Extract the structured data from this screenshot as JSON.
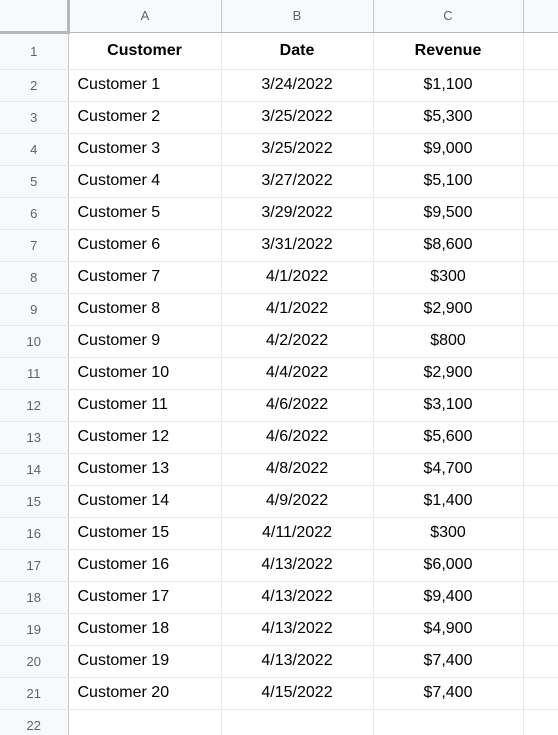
{
  "spreadsheet": {
    "column_headers": [
      "A",
      "B",
      "C",
      ""
    ],
    "header_row": {
      "number": "1",
      "cells": [
        "Customer",
        "Date",
        "Revenue"
      ]
    },
    "rows": [
      {
        "number": "2",
        "cells": [
          "Customer 1",
          "3/24/2022",
          "$1,100"
        ]
      },
      {
        "number": "3",
        "cells": [
          "Customer 2",
          "3/25/2022",
          "$5,300"
        ]
      },
      {
        "number": "4",
        "cells": [
          "Customer 3",
          "3/25/2022",
          "$9,000"
        ]
      },
      {
        "number": "5",
        "cells": [
          "Customer 4",
          "3/27/2022",
          "$5,100"
        ]
      },
      {
        "number": "6",
        "cells": [
          "Customer 5",
          "3/29/2022",
          "$9,500"
        ]
      },
      {
        "number": "7",
        "cells": [
          "Customer 6",
          "3/31/2022",
          "$8,600"
        ]
      },
      {
        "number": "8",
        "cells": [
          "Customer 7",
          "4/1/2022",
          "$300"
        ]
      },
      {
        "number": "9",
        "cells": [
          "Customer 8",
          "4/1/2022",
          "$2,900"
        ]
      },
      {
        "number": "10",
        "cells": [
          "Customer 9",
          "4/2/2022",
          "$800"
        ]
      },
      {
        "number": "11",
        "cells": [
          "Customer 10",
          "4/4/2022",
          "$2,900"
        ]
      },
      {
        "number": "12",
        "cells": [
          "Customer 11",
          "4/6/2022",
          "$3,100"
        ]
      },
      {
        "number": "13",
        "cells": [
          "Customer 12",
          "4/6/2022",
          "$5,600"
        ]
      },
      {
        "number": "14",
        "cells": [
          "Customer 13",
          "4/8/2022",
          "$4,700"
        ]
      },
      {
        "number": "15",
        "cells": [
          "Customer 14",
          "4/9/2022",
          "$1,400"
        ]
      },
      {
        "number": "16",
        "cells": [
          "Customer 15",
          "4/11/2022",
          "$300"
        ]
      },
      {
        "number": "17",
        "cells": [
          "Customer 16",
          "4/13/2022",
          "$6,000"
        ]
      },
      {
        "number": "18",
        "cells": [
          "Customer 17",
          "4/13/2022",
          "$9,400"
        ]
      },
      {
        "number": "19",
        "cells": [
          "Customer 18",
          "4/13/2022",
          "$4,900"
        ]
      },
      {
        "number": "20",
        "cells": [
          "Customer 19",
          "4/13/2022",
          "$7,400"
        ]
      },
      {
        "number": "21",
        "cells": [
          "Customer 20",
          "4/15/2022",
          "$7,400"
        ]
      }
    ],
    "empty_rows": [
      {
        "number": "22",
        "cells": [
          "",
          "",
          ""
        ]
      }
    ],
    "colors": {
      "header_background": "#f8f9fa",
      "header_text": "#5f6368",
      "gridline": "#e8eaed",
      "header_border": "#c4c7c5",
      "cell_text": "#000000",
      "cell_background": "#ffffff"
    }
  }
}
